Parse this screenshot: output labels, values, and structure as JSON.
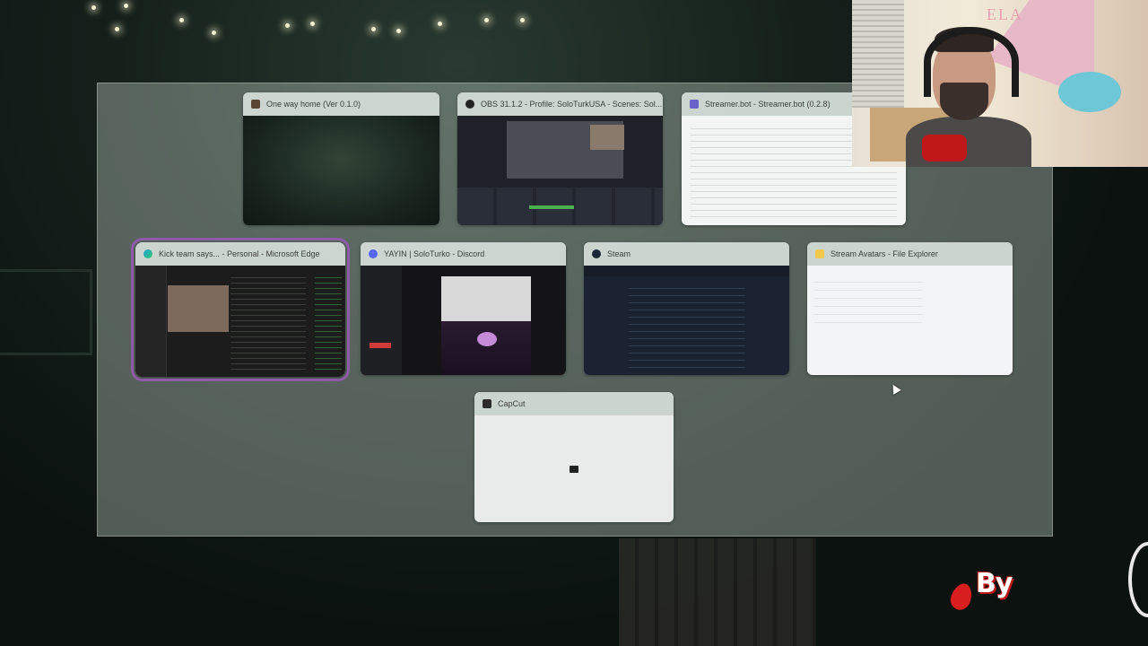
{
  "windows": [
    {
      "title": "One way home (Ver 0.1.0)",
      "icon": "game-icon",
      "selected": false
    },
    {
      "title": "OBS 31.1.2 - Profile: SoloTurkUSA - Scenes: Sol...",
      "icon": "obs-icon",
      "selected": false
    },
    {
      "title": "Streamer.bot - Streamer.bot (0.2.8)",
      "icon": "streamerbot-icon",
      "selected": false
    },
    {
      "title": "Kick team says... - Personal - Microsoft Edge",
      "icon": "edge-icon",
      "selected": true
    },
    {
      "title": "YAYIN | SoloTurko - Discord",
      "icon": "discord-icon",
      "selected": false
    },
    {
      "title": "Steam",
      "icon": "steam-icon",
      "selected": false
    },
    {
      "title": "Stream Avatars - File Explorer",
      "icon": "folder-icon",
      "selected": false
    },
    {
      "title": "CapCut",
      "icon": "capcut-icon",
      "selected": false
    }
  ],
  "webcam": {
    "sign_text": "ELA"
  },
  "overlay": {
    "watermark_text": "By"
  },
  "colors": {
    "selection": "#8f5aa8",
    "panel": "rgba(180,196,186,0.42)",
    "watermark": "#c01818"
  }
}
